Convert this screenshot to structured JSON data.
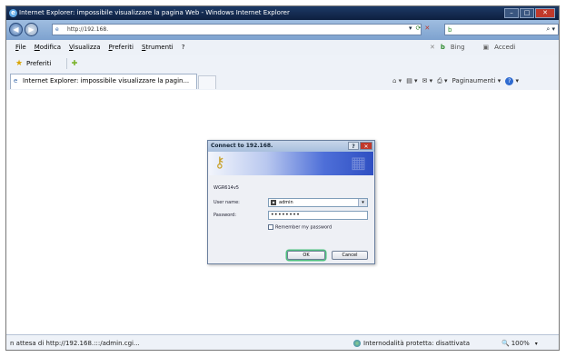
{
  "window": {
    "title": "Internet Explorer: impossibile visualizzare la pagina Web - Windows Internet Explorer"
  },
  "address": {
    "url": "http://192.168."
  },
  "menu": {
    "items": [
      "File",
      "Modifica",
      "Visualizza",
      "Preferiti",
      "Strumenti",
      "?"
    ]
  },
  "toolbar_right": {
    "search_engine": "Bing",
    "accedi": "Accedi"
  },
  "favorites": {
    "label": "Preferiti"
  },
  "tab": {
    "label": "Internet Explorer: impossibile visualizzare la pagin..."
  },
  "commandbar": {
    "page_menu": "Paginaumenti ▾"
  },
  "dialog": {
    "title": "Connect to 192.168.",
    "realm": "WGR614v5",
    "username_label": "User name:",
    "username_value": "admin",
    "password_label": "Password:",
    "password_value": "••••••••",
    "remember_label": "Remember my password",
    "ok_label": "OK",
    "cancel_label": "Cancel"
  },
  "status": {
    "text": "n attesa di http://192.168.:::/admin.cgi...",
    "protected_mode": "Internodalità protetta: disattivata",
    "zoom": "100%"
  }
}
